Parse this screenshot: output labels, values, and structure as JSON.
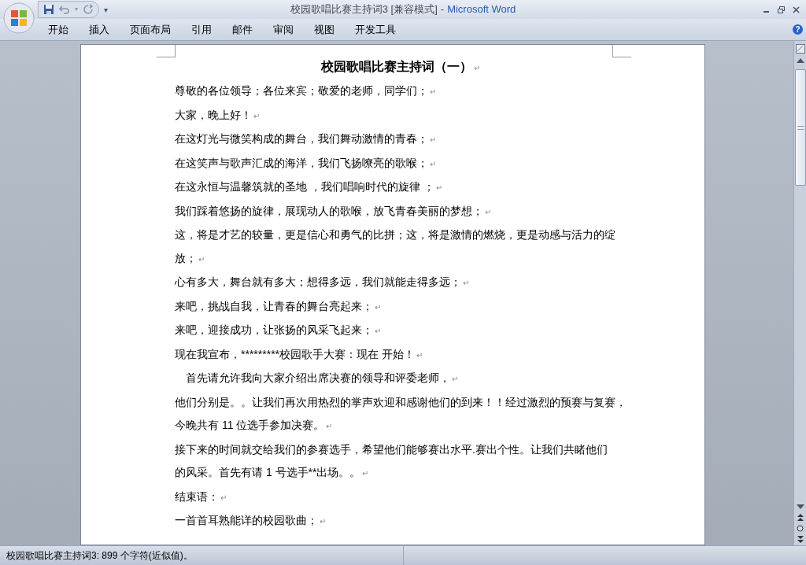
{
  "window": {
    "title_document": "校园歌唱比赛主持词3 [兼容模式]",
    "title_separator": "-",
    "title_app": "Microsoft Word"
  },
  "quick_access": {
    "undo_dropdown_glyph": "▾",
    "customize_glyph": "▾"
  },
  "help_glyph": "?",
  "tabs": [
    {
      "label": "开始",
      "selected": false
    },
    {
      "label": "插入",
      "selected": false
    },
    {
      "label": "页面布局",
      "selected": false
    },
    {
      "label": "引用",
      "selected": false
    },
    {
      "label": "邮件",
      "selected": false
    },
    {
      "label": "审阅",
      "selected": false
    },
    {
      "label": "视图",
      "selected": false
    },
    {
      "label": "开发工具",
      "selected": false
    }
  ],
  "document": {
    "title": "校园歌唱比赛主持词（一）",
    "title_mark": "↵",
    "paragraphs": [
      {
        "text": "尊敬的各位领导；各位来宾；敬爱的老师，同学们；",
        "mark": "↵",
        "indent": false
      },
      {
        "text": "大家，晚上好！",
        "mark": "↵",
        "indent": false
      },
      {
        "text": "在这灯光与微笑构成的舞台，我们舞动激情的青春；",
        "mark": "↵",
        "indent": false
      },
      {
        "text": "在这笑声与歌声汇成的海洋，我们飞扬嘹亮的歌喉；",
        "mark": "↵",
        "indent": false
      },
      {
        "text": "在这永恒与温馨筑就的圣地 ，我们唱响时代的旋律 ；",
        "mark": "↵",
        "indent": false
      },
      {
        "text": "我们踩着悠扬的旋律，展现动人的歌喉，放飞青春美丽的梦想；",
        "mark": "↵",
        "indent": false
      },
      {
        "text": "这，将是才艺的较量，更是信心和勇气的比拼；这，将是激情的燃烧，更是动感与活力的绽",
        "text_continued": "放；",
        "mark": "↵",
        "indent": false
      },
      {
        "text": "心有多大，舞台就有多大；想得多远，我们就能走得多远；",
        "mark": "↵",
        "indent": false
      },
      {
        "text": "来吧，挑战自我，让青春的舞台亮起来；",
        "mark": "↵",
        "indent": false
      },
      {
        "text": "来吧，迎接成功，让张扬的风采飞起来；",
        "mark": "↵",
        "indent": false
      },
      {
        "text": "现在我宣布，*********校园歌手大赛：现在 开始！",
        "mark": "↵",
        "indent": false
      },
      {
        "text": "首先请允许我向大家介绍出席决赛的领导和评委老师，",
        "mark": "↵",
        "indent": true
      },
      {
        "text": "他们分别是。。让我们再次用热烈的掌声欢迎和感谢他们的到来！！经过激烈的预赛与复赛，",
        "text_continued": "今晚共有 11 位选手参加决赛。",
        "mark": "↵",
        "indent": false
      },
      {
        "text": "接下来的时间就交给我们的参赛选手，希望他们能够赛出水平.赛出个性。让我们共睹他们",
        "text_continued": "的风采。首先有请 1 号选手**出场。。",
        "mark": "↵",
        "indent": false
      },
      {
        "text": "结束语：",
        "mark": "↵",
        "indent": false
      },
      {
        "text": "一首首耳熟能详的校园歌曲；",
        "mark": "↵",
        "indent": false
      }
    ]
  },
  "status_bar": {
    "text": "校园歌唱比赛主持词3: 899 个字符(近似值)。"
  }
}
